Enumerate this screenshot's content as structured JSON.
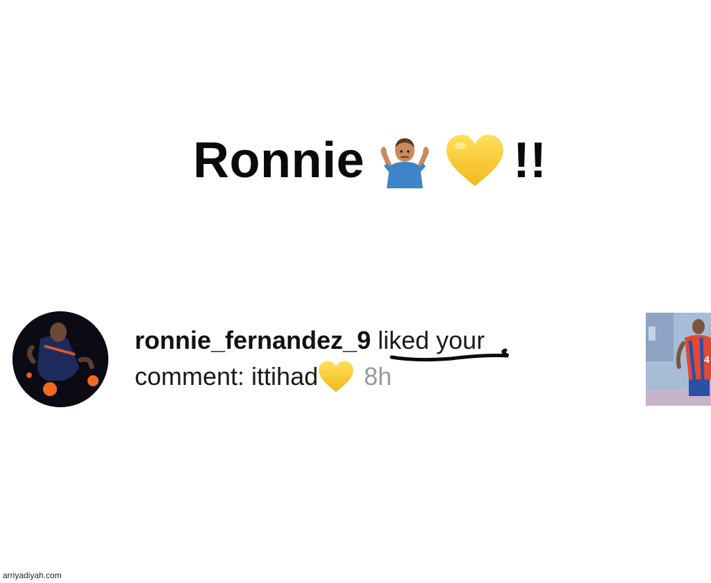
{
  "headline": {
    "name": "Ronnie",
    "suffix": "!!",
    "emojis": [
      "person-shrugging-icon",
      "yellow-heart-icon"
    ]
  },
  "notification": {
    "username": "ronnie_fernandez_9",
    "action": " liked your",
    "line2": "comment: ittihad",
    "time": "8h",
    "avatar_icon": "profile-photo",
    "thumbnail_icon": "post-thumbnail",
    "heart_color": "#f6c427"
  },
  "watermark": "arriyadiyah.com"
}
